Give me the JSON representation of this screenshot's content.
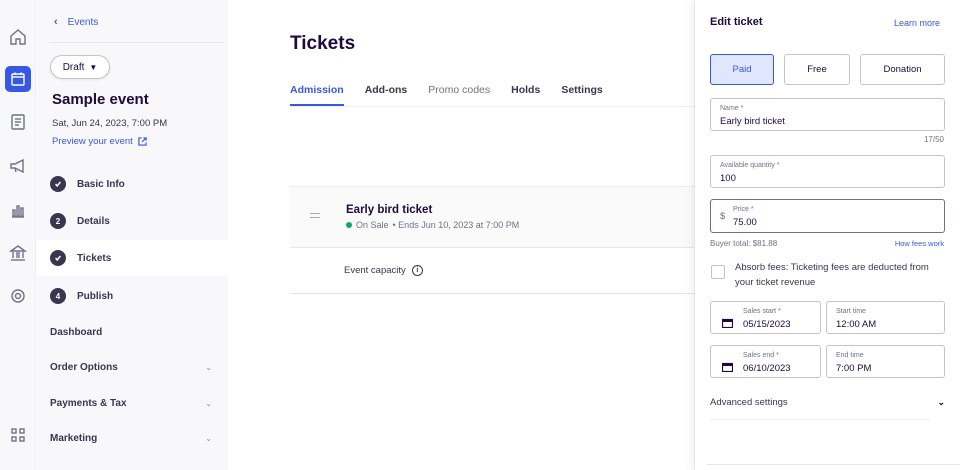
{
  "rail": {
    "icons": [
      "home-icon",
      "calendar-icon",
      "orders-icon",
      "megaphone-icon",
      "reports-icon",
      "finance-icon",
      "settings-icon",
      "apps-icon"
    ],
    "active_color": "#3659e3"
  },
  "sidebar": {
    "back_label": "Events",
    "status_label": "Draft",
    "event_title": "Sample event",
    "event_date": "Sat, Jun 24, 2023, 7:00 PM",
    "preview_label": "Preview your event",
    "steps": [
      {
        "label": "Basic Info",
        "badge": "check",
        "state": "done"
      },
      {
        "label": "Details",
        "badge": "2",
        "state": "todo"
      },
      {
        "label": "Tickets",
        "badge": "check",
        "state": "active"
      },
      {
        "label": "Publish",
        "badge": "4",
        "state": "todo"
      }
    ],
    "sections": [
      {
        "label": "Dashboard",
        "expandable": false
      },
      {
        "label": "Order Options",
        "expandable": true
      },
      {
        "label": "Payments & Tax",
        "expandable": true
      },
      {
        "label": "Marketing",
        "expandable": true
      }
    ]
  },
  "main": {
    "title": "Tickets",
    "tabs": [
      {
        "label": "Admission",
        "active": true
      },
      {
        "label": "Add-ons",
        "active": false
      },
      {
        "label": "Promo codes",
        "active": false
      },
      {
        "label": "Holds",
        "active": false
      },
      {
        "label": "Settings",
        "active": false
      }
    ],
    "ticket": {
      "name": "Early bird ticket",
      "status": "On Sale",
      "status_detail": "• Ends Jun 10, 2023 at 7:00 PM",
      "status_color": "#14a85b"
    },
    "capacity_label": "Event capacity",
    "info_glyph": "i"
  },
  "panel": {
    "title": "Edit ticket",
    "learn_more": "Learn more",
    "types": [
      {
        "label": "Paid",
        "active": true
      },
      {
        "label": "Free",
        "active": false
      },
      {
        "label": "Donation",
        "active": false
      }
    ],
    "name_field": {
      "label": "Name",
      "value": "Early bird ticket",
      "counter": "17/50"
    },
    "quantity_field": {
      "label": "Available quantity",
      "value": "100"
    },
    "price_field": {
      "label": "Price",
      "currency": "$",
      "value": "75.00"
    },
    "required_mark": "*",
    "buyer_total": "Buyer total: $81.88",
    "how_fees": "How fees work",
    "absorb_text": "Absorb fees: Ticketing fees are deducted from your ticket revenue",
    "sales_start": {
      "label": "Sales start",
      "value": "05/15/2023"
    },
    "start_time": {
      "label": "Start time",
      "value": "12:00 AM"
    },
    "sales_end": {
      "label": "Sales end",
      "value": "06/10/2023"
    },
    "end_time": {
      "label": "End time",
      "value": "7:00 PM"
    },
    "advanced_label": "Advanced settings"
  }
}
